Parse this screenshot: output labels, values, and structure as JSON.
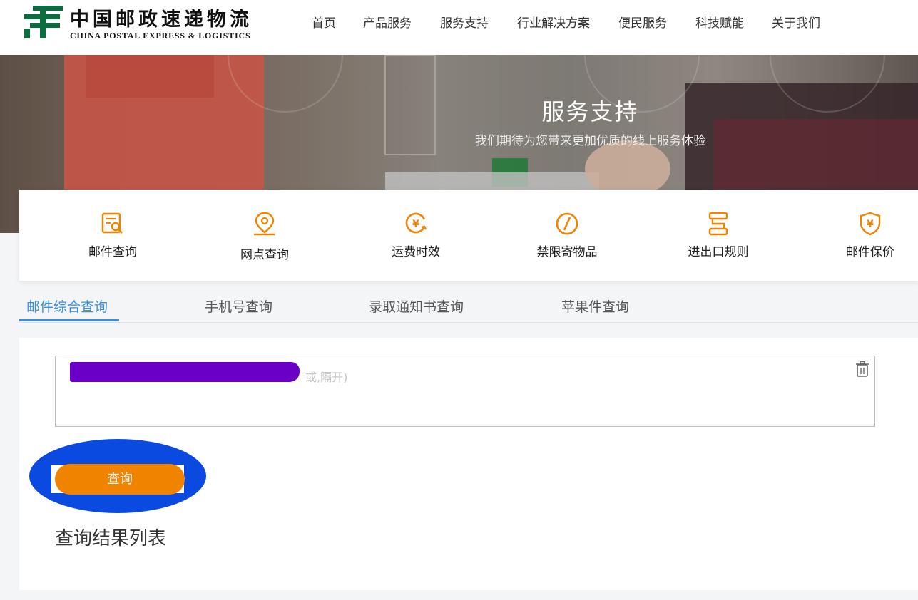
{
  "header": {
    "logo_cn": "中国邮政速递物流",
    "logo_en": "CHINA POSTAL EXPRESS & LOGISTICS",
    "nav": [
      "首页",
      "产品服务",
      "服务支持",
      "行业解决方案",
      "便民服务",
      "科技赋能",
      "关于我们"
    ]
  },
  "banner": {
    "title": "服务支持",
    "subtitle": "我们期待为您带来更加优质的线上服务体验"
  },
  "services": [
    {
      "label": "邮件查询",
      "icon": "mail-search-icon"
    },
    {
      "label": "网点查询",
      "icon": "location-icon"
    },
    {
      "label": "运费时效",
      "icon": "yuan-clock-icon"
    },
    {
      "label": "禁限寄物品",
      "icon": "prohibited-icon"
    },
    {
      "label": "进出口规则",
      "icon": "rules-icon"
    },
    {
      "label": "邮件保价",
      "icon": "shield-yuan-icon"
    }
  ],
  "tabs": [
    "邮件综合查询",
    "手机号查询",
    "录取通知书查询",
    "苹果件查询"
  ],
  "query": {
    "placeholder_visible": "或,隔开)",
    "button_label": "查询",
    "result_title": "查询结果列表"
  },
  "colors": {
    "accent_orange": "#f08300",
    "tab_blue": "#3b8de0",
    "logo_green": "#0b6e3e",
    "annotation_blue": "#0a4ae0",
    "redaction_purple": "#6a00c8"
  }
}
